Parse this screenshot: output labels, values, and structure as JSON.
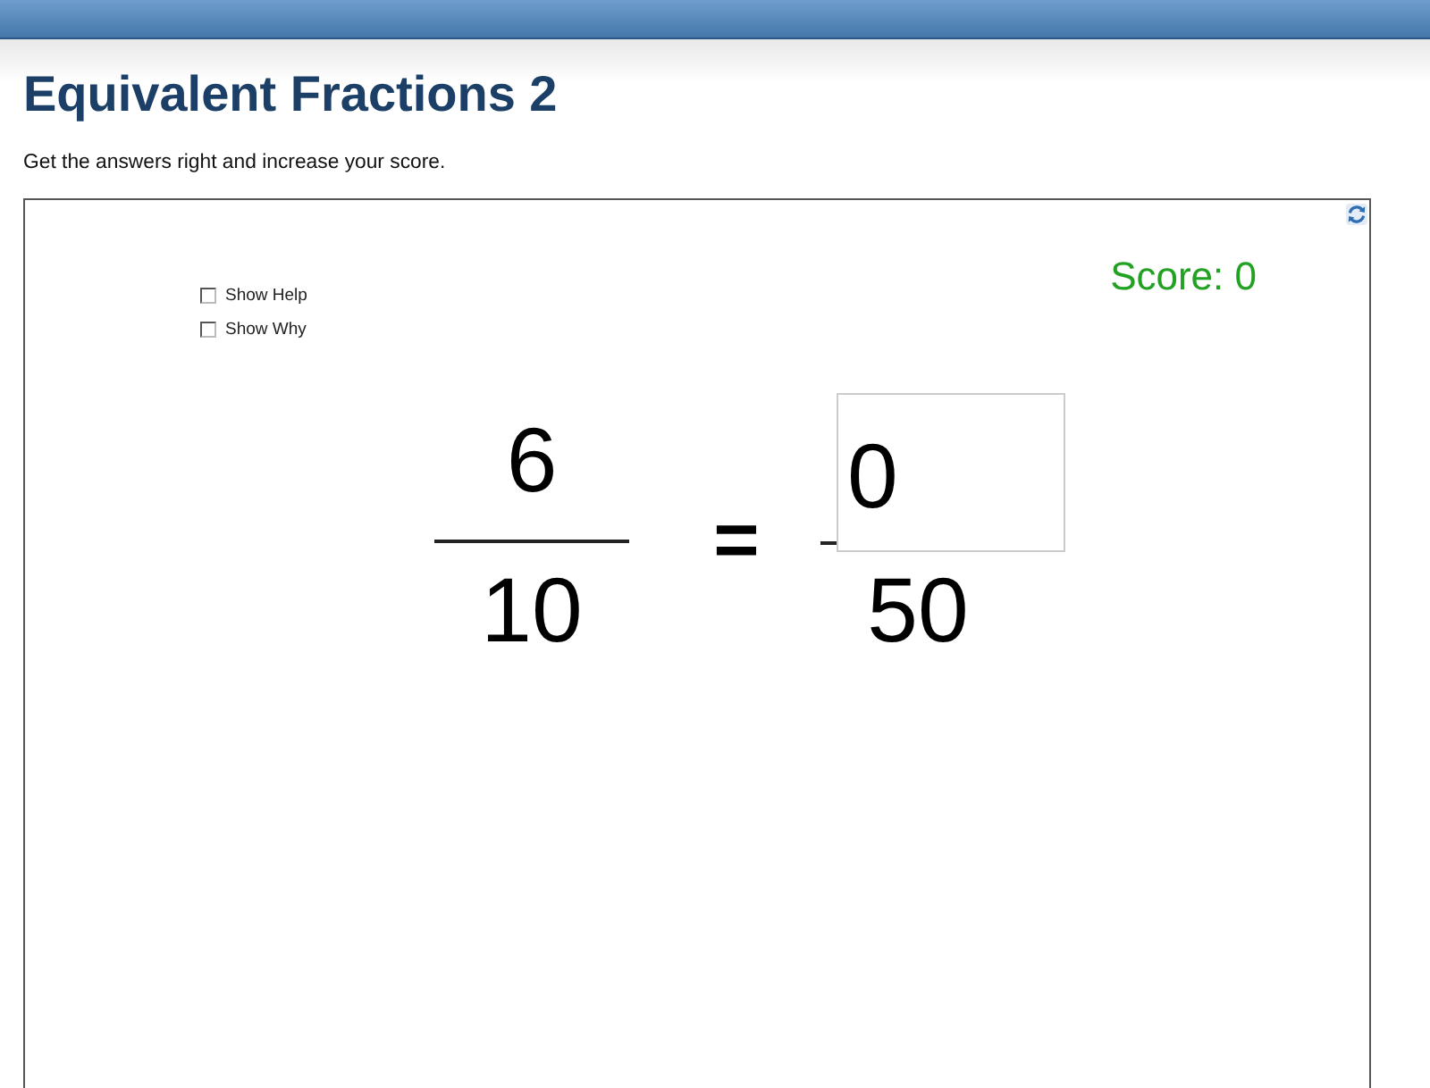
{
  "header": {
    "title": "Equivalent Fractions 2",
    "subtitle": "Get the answers right and increase your score."
  },
  "activity": {
    "options": [
      {
        "label": "Show Help",
        "checked": false
      },
      {
        "label": "Show Why",
        "checked": false
      }
    ],
    "score": "Score: 0",
    "left_fraction": {
      "numerator": "6",
      "denominator": "10"
    },
    "operator": "=",
    "right_fraction": {
      "numerator_answer": {
        "value": "0"
      },
      "denominator": "50"
    }
  }
}
